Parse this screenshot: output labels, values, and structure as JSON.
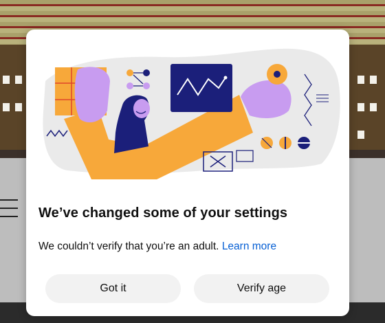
{
  "dialog": {
    "title": "We’ve changed some of your settings",
    "message": "We couldn’t verify that you’re an adult.",
    "learn_more": "Learn more",
    "buttons": {
      "got_it": "Got it",
      "verify_age": "Verify age"
    }
  },
  "colors": {
    "accent_link": "#065fd4",
    "illustration_orange": "#f7a83a",
    "illustration_purple": "#c89cf0",
    "illustration_navy": "#1b1f7a",
    "button_bg": "#f2f2f2"
  }
}
